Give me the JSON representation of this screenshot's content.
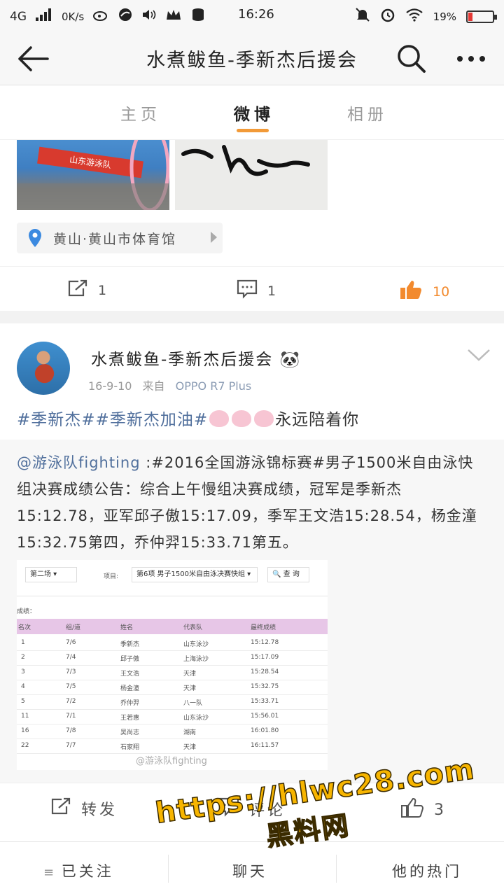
{
  "status_bar": {
    "network": "4G",
    "speed": "0K/s",
    "time": "16:26",
    "battery": "19%",
    "battery_level": 0.19,
    "battery_color": "#e53935"
  },
  "header": {
    "title": "水煮鲅鱼-季新杰后援会",
    "back_icon": "arrow-left-icon",
    "search_icon": "search-icon",
    "more_icon": "more-dots-icon"
  },
  "tabs": [
    {
      "label": "主页",
      "active": false
    },
    {
      "label": "微博",
      "active": true
    },
    {
      "label": "相册",
      "active": false
    }
  ],
  "accent_color": "#f29a38",
  "card1": {
    "banner_text": "山东游泳队",
    "location": "黄山·黄山市体育馆",
    "repost_count": "1",
    "comment_count": "1",
    "like_count": "10"
  },
  "card2": {
    "username": "水煮鲅鱼-季新杰后援会",
    "date": "16-9-10",
    "from_label": "来自",
    "source": "OPPO R7 Plus",
    "text_hashtags": "#季新杰##季新杰加油#",
    "text_tail": "永远陪着你",
    "repost": {
      "mention": "@游泳队fighting",
      "body": " :#2016全国游泳锦标赛#男子1500米自由泳快组决赛成绩公告：综合上午慢组决赛成绩，冠军是季新杰15:12.78，亚军邱子傲15:17.09，季军王文浩15:28.54，杨金潼15:32.75第四，乔仲羿15:33.71第五。"
    },
    "results_table": {
      "session": "第二场",
      "event_label": "项目:",
      "event": "第6项 男子1500米自由泳决赛快组",
      "query_button": "查 询",
      "result_label": "成绩：",
      "columns": [
        "名次",
        "组/道",
        "姓名",
        "代表队",
        "最终成绩"
      ],
      "rows": [
        [
          "1",
          "7/6",
          "季新杰",
          "山东泳沙",
          "15:12.78"
        ],
        [
          "2",
          "7/4",
          "邱子傲",
          "上海泳沙",
          "15:17.09"
        ],
        [
          "3",
          "7/3",
          "王文浩",
          "天津",
          "15:28.54"
        ],
        [
          "4",
          "7/5",
          "杨金潼",
          "天津",
          "15:32.75"
        ],
        [
          "5",
          "7/2",
          "乔仲羿",
          "八一队",
          "15:33.71"
        ],
        [
          "11",
          "7/1",
          "王若惠",
          "山东泳沙",
          "15:56.01"
        ],
        [
          "16",
          "7/8",
          "吴尚志",
          "湖南",
          "16:01.80"
        ],
        [
          "22",
          "7/7",
          "石家翔",
          "天津",
          "16:11.57"
        ]
      ],
      "watermark": "@游泳队fighting"
    },
    "repost_label": "转发",
    "comment_label": "评论",
    "like_count": "3"
  },
  "bottom_bar": {
    "follow": "已关注",
    "chat": "聊天",
    "hot": "他的热门"
  },
  "overlay": {
    "url": "https://hlwc28.com",
    "text": "黑料网",
    "color": "#f7b500"
  }
}
